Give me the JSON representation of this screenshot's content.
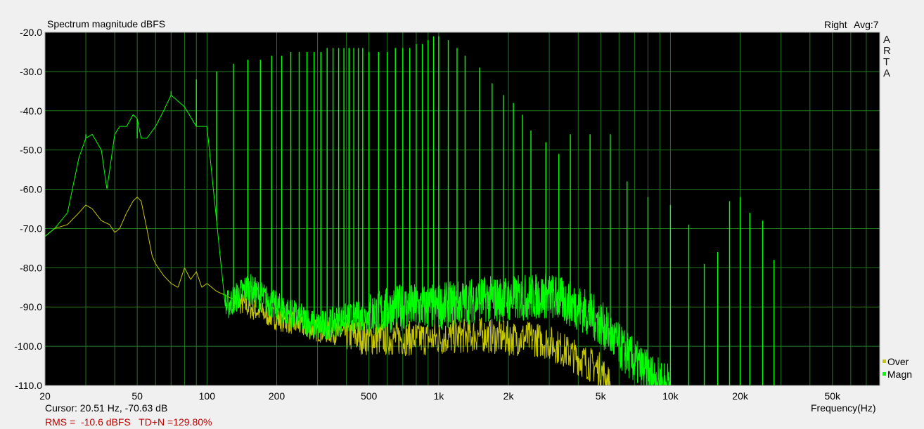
{
  "chart_data": {
    "type": "line",
    "title": "Spectrum magnitude dBFS",
    "channel_label": "Right",
    "avg_label": "Avg:7",
    "brand_letters": [
      "A",
      "R",
      "T",
      "A"
    ],
    "xlabel": "Frequency(Hz)",
    "xscale": "log",
    "xlim": [
      20,
      80000
    ],
    "ylim": [
      -110,
      -20
    ],
    "x_ticks": [
      {
        "v": 20,
        "label": "20"
      },
      {
        "v": 50,
        "label": "50"
      },
      {
        "v": 100,
        "label": "100"
      },
      {
        "v": 200,
        "label": "200"
      },
      {
        "v": 500,
        "label": "500"
      },
      {
        "v": 1000,
        "label": "1k"
      },
      {
        "v": 2000,
        "label": "2k"
      },
      {
        "v": 5000,
        "label": "5k"
      },
      {
        "v": 10000,
        "label": "10k"
      },
      {
        "v": 20000,
        "label": "20k"
      },
      {
        "v": 50000,
        "label": "50k"
      }
    ],
    "y_ticks": [
      {
        "v": -20,
        "label": "-20.0"
      },
      {
        "v": -30,
        "label": "-30.0"
      },
      {
        "v": -40,
        "label": "-40.0"
      },
      {
        "v": -50,
        "label": "-50.0"
      },
      {
        "v": -60,
        "label": "-60.0"
      },
      {
        "v": -70,
        "label": "-70.0"
      },
      {
        "v": -80,
        "label": "-80.0"
      },
      {
        "v": -90,
        "label": "-90.0"
      },
      {
        "v": -100,
        "label": "-100.0"
      },
      {
        "v": -110,
        "label": "-110.0"
      }
    ],
    "grid": true,
    "legend_position": "bottom-right",
    "colors": {
      "background": "#000000",
      "grid": "#1f7a1f",
      "magn": "#00ff00",
      "over": "#c8c800"
    },
    "series": [
      {
        "name": "Over",
        "color": "#c8c800",
        "points": [
          [
            20,
            -72
          ],
          [
            22,
            -70
          ],
          [
            25,
            -69
          ],
          [
            28,
            -66
          ],
          [
            30,
            -64
          ],
          [
            32,
            -65
          ],
          [
            35,
            -68
          ],
          [
            38,
            -69
          ],
          [
            40,
            -71
          ],
          [
            42,
            -70
          ],
          [
            45,
            -66
          ],
          [
            48,
            -63
          ],
          [
            50,
            -62
          ],
          [
            52,
            -63
          ],
          [
            55,
            -70
          ],
          [
            58,
            -77
          ],
          [
            60,
            -79
          ],
          [
            65,
            -82
          ],
          [
            70,
            -84
          ],
          [
            75,
            -85
          ],
          [
            80,
            -80
          ],
          [
            85,
            -83
          ],
          [
            90,
            -81
          ],
          [
            95,
            -85
          ],
          [
            100,
            -84
          ],
          [
            110,
            -86
          ],
          [
            120,
            -87
          ],
          [
            150,
            -90
          ],
          [
            200,
            -93
          ],
          [
            300,
            -96
          ],
          [
            400,
            -97
          ],
          [
            500,
            -98
          ],
          [
            700,
            -98
          ],
          [
            1000,
            -98
          ],
          [
            1500,
            -97
          ],
          [
            2000,
            -98
          ],
          [
            2500,
            -98
          ],
          [
            3000,
            -99
          ],
          [
            4000,
            -103
          ],
          [
            5000,
            -106
          ],
          [
            5500,
            -110
          ]
        ]
      },
      {
        "name": "Magn",
        "color": "#00ff00",
        "envelope": [
          [
            20,
            -72
          ],
          [
            22,
            -70
          ],
          [
            25,
            -66
          ],
          [
            28,
            -52
          ],
          [
            30,
            -47
          ],
          [
            32,
            -46
          ],
          [
            35,
            -50
          ],
          [
            37,
            -60
          ],
          [
            40,
            -46
          ],
          [
            42,
            -44
          ],
          [
            45,
            -44
          ],
          [
            48,
            -41
          ],
          [
            50,
            -42
          ],
          [
            52,
            -47
          ],
          [
            55,
            -47
          ],
          [
            60,
            -44
          ],
          [
            65,
            -40
          ],
          [
            70,
            -36
          ],
          [
            80,
            -39
          ],
          [
            90,
            -44
          ],
          [
            100,
            -44
          ],
          [
            120,
            -90
          ],
          [
            150,
            -85
          ],
          [
            200,
            -90
          ],
          [
            300,
            -95
          ],
          [
            400,
            -93
          ],
          [
            500,
            -92
          ],
          [
            700,
            -90
          ],
          [
            1000,
            -90
          ],
          [
            1500,
            -88
          ],
          [
            2000,
            -88
          ],
          [
            3000,
            -87
          ],
          [
            4000,
            -90
          ],
          [
            5000,
            -94
          ],
          [
            6000,
            -100
          ],
          [
            7000,
            -104
          ],
          [
            8000,
            -107
          ],
          [
            9000,
            -109
          ],
          [
            10000,
            -110
          ]
        ],
        "harmonics": [
          [
            30,
            -46
          ],
          [
            50,
            -47
          ],
          [
            70,
            -35
          ],
          [
            90,
            -32
          ],
          [
            110,
            -30
          ],
          [
            130,
            -28
          ],
          [
            150,
            -27
          ],
          [
            170,
            -27
          ],
          [
            190,
            -26
          ],
          [
            210,
            -26
          ],
          [
            230,
            -25
          ],
          [
            250,
            -25
          ],
          [
            270,
            -25
          ],
          [
            290,
            -25
          ],
          [
            310,
            -25
          ],
          [
            330,
            -24
          ],
          [
            350,
            -24
          ],
          [
            370,
            -24
          ],
          [
            390,
            -24
          ],
          [
            410,
            -24
          ],
          [
            430,
            -24
          ],
          [
            450,
            -24
          ],
          [
            470,
            -24
          ],
          [
            500,
            -25
          ],
          [
            550,
            -25
          ],
          [
            600,
            -25
          ],
          [
            650,
            -24
          ],
          [
            700,
            -24
          ],
          [
            750,
            -24
          ],
          [
            800,
            -23
          ],
          [
            850,
            -23
          ],
          [
            900,
            -22
          ],
          [
            950,
            -21
          ],
          [
            1000,
            -21
          ],
          [
            1100,
            -22
          ],
          [
            1200,
            -24
          ],
          [
            1300,
            -26
          ],
          [
            1500,
            -29
          ],
          [
            1700,
            -33
          ],
          [
            1900,
            -36
          ],
          [
            2100,
            -38
          ],
          [
            2300,
            -41
          ],
          [
            2500,
            -45
          ],
          [
            2900,
            -48
          ],
          [
            3300,
            -51
          ],
          [
            3700,
            -46
          ],
          [
            4500,
            -46
          ],
          [
            5500,
            -46
          ],
          [
            6500,
            -58
          ],
          [
            8000,
            -62
          ],
          [
            10000,
            -64
          ],
          [
            12000,
            -69
          ],
          [
            14000,
            -79
          ],
          [
            16000,
            -76
          ],
          [
            18000,
            -63
          ],
          [
            20000,
            -62
          ],
          [
            22000,
            -66
          ],
          [
            25000,
            -68
          ],
          [
            28000,
            -78
          ]
        ]
      }
    ],
    "legend": [
      "Over",
      "Magn"
    ],
    "cursor_text": "Cursor: 20.51 Hz, -70.63 dB",
    "rms_text": "RMS =  -10.6 dBFS   TD+N =129.80%"
  }
}
